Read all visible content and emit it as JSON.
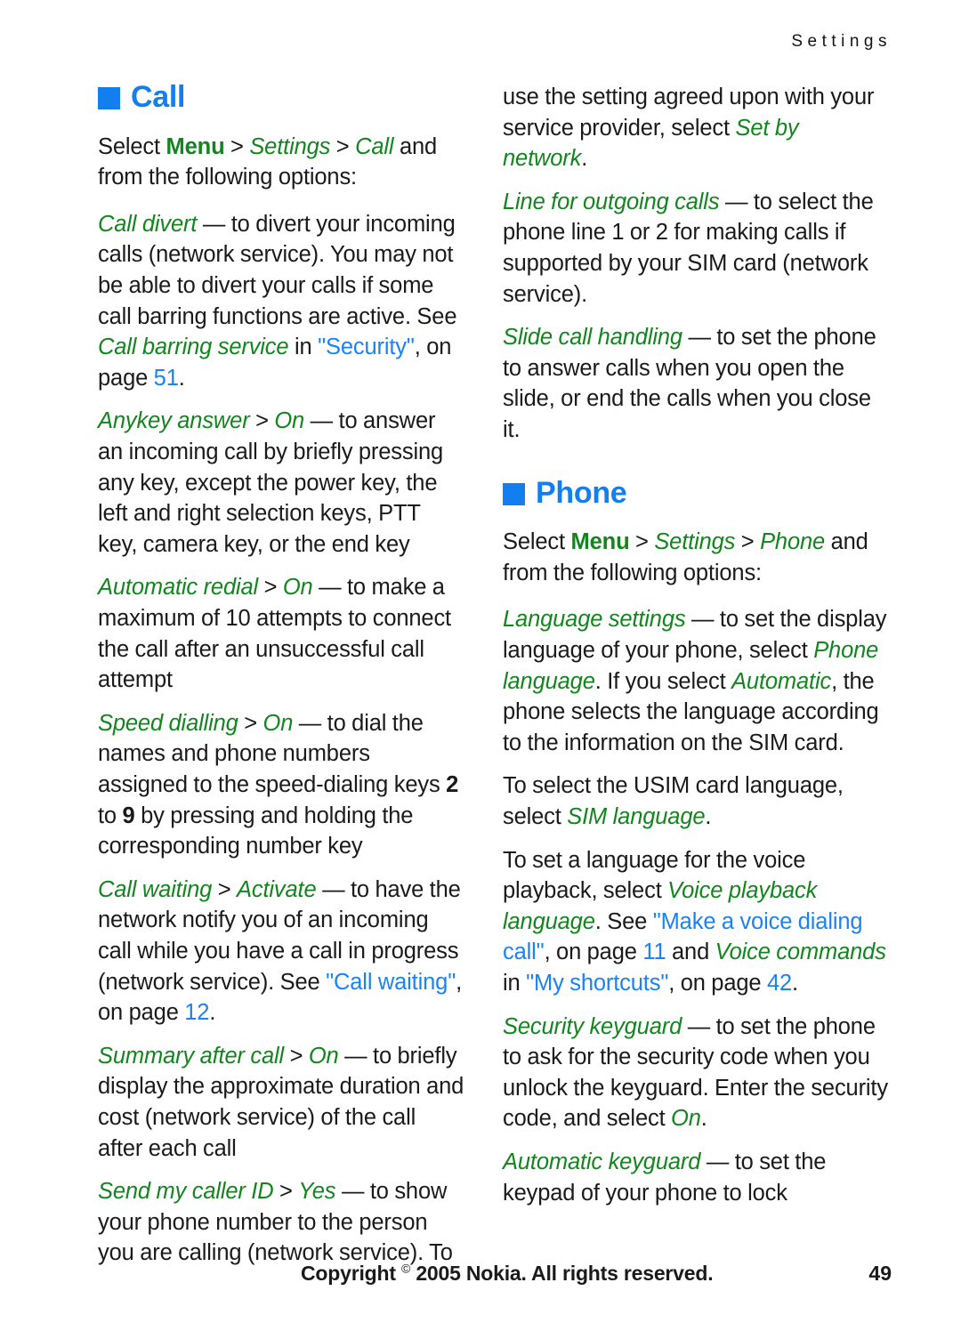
{
  "header": {
    "running_head": "Settings"
  },
  "colors": {
    "heading_blue": "#127ef0",
    "term_green": "#13851f",
    "xref_blue": "#1a82f5",
    "body_black": "#1a1a1a"
  },
  "left_column": {
    "heading": "Call",
    "p1": {
      "t1": "Select ",
      "menu": "Menu",
      "t2": " > ",
      "settings": "Settings",
      "t3": " > ",
      "call": "Call",
      "t4": " and from the following options:"
    },
    "p2": {
      "term": "Call divert",
      "t1": " — to divert your incoming calls (network service). You may not be able to divert your calls if some call barring functions are active. See ",
      "term2": "Call barring service",
      "t2": " in ",
      "xref": "\"Security\"",
      "t3": ", on page ",
      "page": "51",
      "t4": "."
    },
    "p3": {
      "term": "Anykey answer",
      "t1": " > ",
      "term2": "On",
      "t2": " — to answer an incoming call by briefly pressing any key, except the power key, the left and right selection keys, PTT key, camera key, or the end key"
    },
    "p4": {
      "term": "Automatic redial",
      "t1": " > ",
      "term2": "On",
      "t2": " — to make a maximum of 10 attempts to connect the call after an unsuccessful call attempt"
    },
    "p5": {
      "term": "Speed dialling",
      "t1": " > ",
      "term2": "On",
      "t2": " — to dial the names and phone numbers assigned to the speed-dialing keys ",
      "key_a": "2",
      "t3": " to ",
      "key_b": "9",
      "t4": " by pressing and holding the corresponding number key"
    },
    "p6": {
      "term": "Call waiting",
      "t1": " > ",
      "term2": "Activate",
      "t2": " — to have the network notify you of an incoming call while you have a call in progress (network service). See ",
      "xref": "\"Call waiting\"",
      "t3": ", on page ",
      "page": "12",
      "t4": "."
    },
    "p7": {
      "term": "Summary after call",
      "t1": " > ",
      "term2": "On",
      "t2": " — to briefly display the approximate duration and cost (network service) of the call after each call"
    },
    "p8": {
      "term": "Send my caller ID",
      "t1": " > ",
      "term2": "Yes",
      "t2": " — to show your phone number to the person you are calling (network service). To"
    }
  },
  "right_column": {
    "p1": {
      "t1": "use the setting agreed upon with your service provider, select ",
      "term": "Set by network",
      "t2": "."
    },
    "p2": {
      "term": "Line for outgoing calls",
      "t1": " — to select the phone line 1 or 2 for making calls if supported by your SIM card (network service)."
    },
    "p3": {
      "term": "Slide call handling",
      "t1": " — to set the phone to answer calls when you open the slide, or end the calls when you close it."
    },
    "heading": "Phone",
    "p4": {
      "t1": "Select ",
      "menu": "Menu",
      "t2": " > ",
      "settings": "Settings",
      "t3": " > ",
      "phone": "Phone",
      "t4": " and from the following options:"
    },
    "p5": {
      "term": "Language settings",
      "t1": " — to set the display language of your phone, select ",
      "term2": "Phone language",
      "t2": ". If you select ",
      "term3": "Automatic",
      "t3": ", the phone selects the language according to the information on the SIM card."
    },
    "p6": {
      "t1": "To select the USIM card language, select ",
      "term": "SIM language",
      "t2": "."
    },
    "p7": {
      "t1": "To set a language for the voice playback, select ",
      "term": "Voice playback language",
      "t2": ". See ",
      "xref": "\"Make a voice dialing call\"",
      "t3": ", on page ",
      "page": "11",
      "t4": " and ",
      "term2": "Voice commands",
      "t5": " in ",
      "xref2": "\"My shortcuts\"",
      "t6": ", on page ",
      "page2": "42",
      "t7": "."
    },
    "p8": {
      "term": "Security keyguard",
      "t1": " — to set the phone to ask for the security code when you unlock the keyguard. Enter the security code, and select ",
      "term2": "On",
      "t2": "."
    },
    "p9": {
      "term": "Automatic keyguard",
      "t1": " — to set the keypad of your phone to lock"
    }
  },
  "footer": {
    "copyright_pre": "Copyright ",
    "copyright_symbol": "©",
    "copyright_post": " 2005 Nokia. All rights reserved.",
    "page_number": "49"
  }
}
